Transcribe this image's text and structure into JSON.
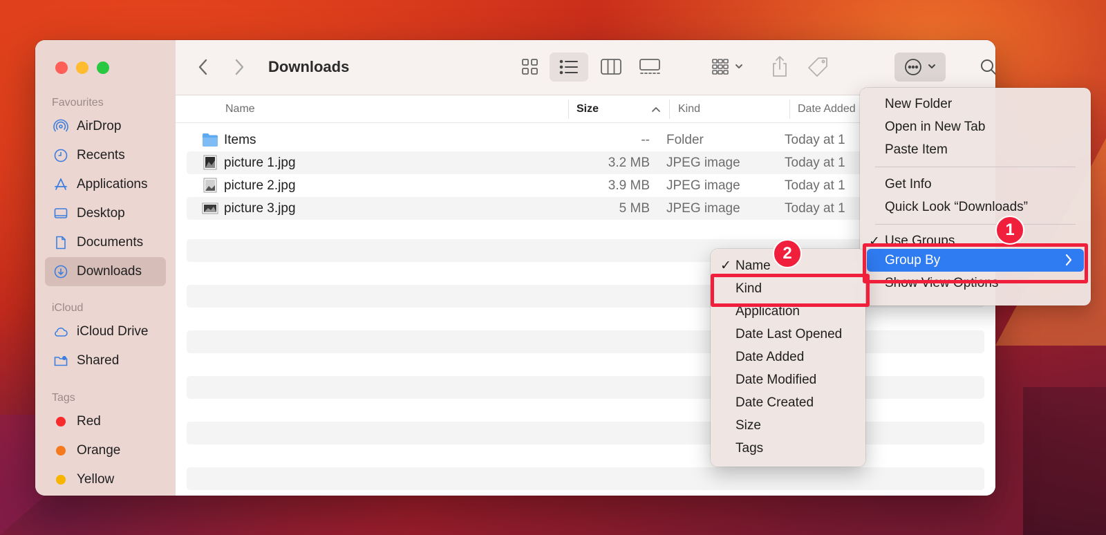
{
  "window": {
    "title": "Downloads"
  },
  "sidebar": {
    "sections": {
      "favourites": "Favourites",
      "icloud": "iCloud",
      "tags": "Tags"
    },
    "favourites": [
      {
        "label": "AirDrop",
        "icon": "airdrop-icon"
      },
      {
        "label": "Recents",
        "icon": "clock-icon"
      },
      {
        "label": "Applications",
        "icon": "applications-icon"
      },
      {
        "label": "Desktop",
        "icon": "desktop-icon"
      },
      {
        "label": "Documents",
        "icon": "document-icon"
      },
      {
        "label": "Downloads",
        "icon": "download-icon",
        "active": true
      }
    ],
    "icloud": [
      {
        "label": "iCloud Drive",
        "icon": "cloud-icon"
      },
      {
        "label": "Shared",
        "icon": "shared-folder-icon"
      }
    ],
    "tags": [
      {
        "label": "Red",
        "color": "#f62b2b"
      },
      {
        "label": "Orange",
        "color": "#f57a1e"
      },
      {
        "label": "Yellow",
        "color": "#f7b500"
      }
    ]
  },
  "columns": {
    "name": "Name",
    "size": "Size",
    "kind": "Kind",
    "date_added": "Date Added"
  },
  "files": [
    {
      "name": "Items",
      "size": "--",
      "kind": "Folder",
      "date": "Today at 1",
      "icon": "folder-icon"
    },
    {
      "name": "picture 1.jpg",
      "size": "3.2 MB",
      "kind": "JPEG image",
      "date": "Today at 1",
      "icon": "image-file-icon"
    },
    {
      "name": "picture 2.jpg",
      "size": "3.9 MB",
      "kind": "JPEG image",
      "date": "Today at 1",
      "icon": "image-file-icon"
    },
    {
      "name": "picture 3.jpg",
      "size": "5 MB",
      "kind": "JPEG image",
      "date": "Today at 1",
      "icon": "image-file-icon"
    }
  ],
  "context_menu": {
    "new_folder": "New Folder",
    "open_new_tab": "Open in New Tab",
    "paste_item": "Paste Item",
    "get_info": "Get Info",
    "quick_look": "Quick Look “Downloads”",
    "use_groups": "Use Groups",
    "group_by": "Group By",
    "show_view_options": "Show View Options"
  },
  "submenu": {
    "check": "✓",
    "items": [
      "Name",
      "Kind",
      "Application",
      "Date Last Opened",
      "Date Added",
      "Date Modified",
      "Date Created",
      "Size",
      "Tags"
    ]
  },
  "annotations": {
    "badge1": "1",
    "badge2": "2",
    "color": "#f01f3c"
  },
  "colors": {
    "highlight": "#2f7cf2",
    "sidebar_bg": "#ecd6d2"
  }
}
